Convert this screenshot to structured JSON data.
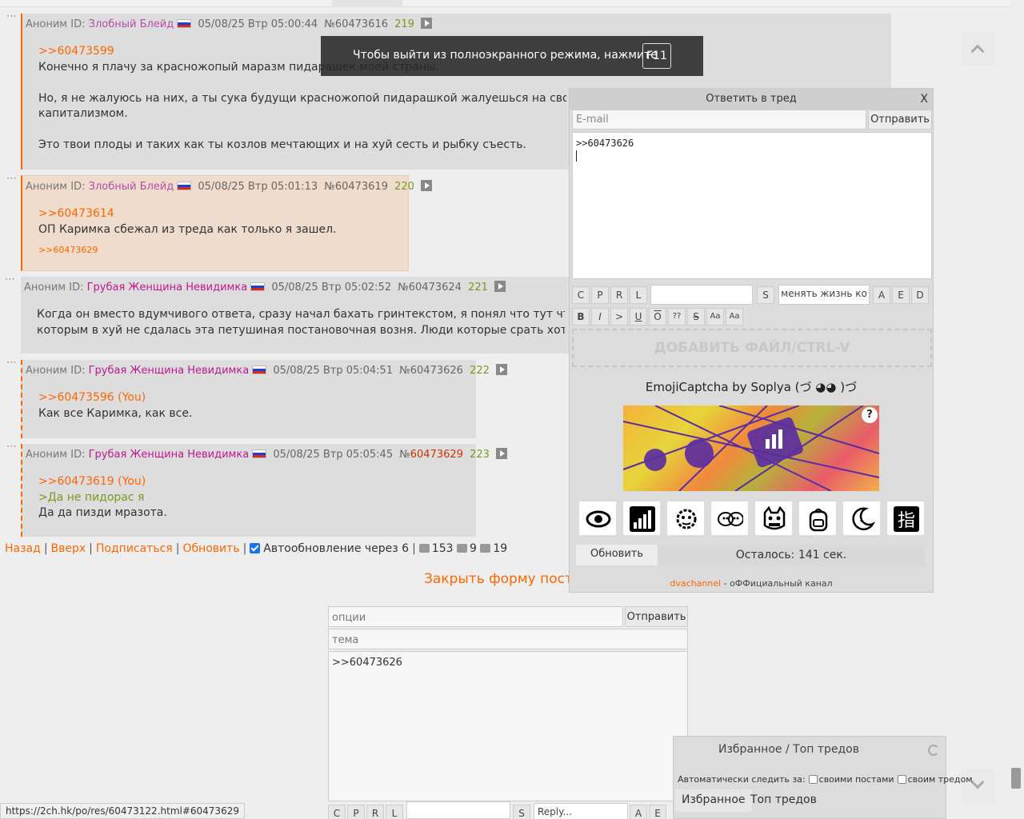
{
  "posts": [
    {
      "anon": "Аноним ID:",
      "name": "Злобный Блейд",
      "date": "05/08/25 Втр 05:00:44",
      "num": "№60473616",
      "count": "219",
      "ref": ">>60473599",
      "lines": [
        "Конечно я плачу за красножопый маразм пидарашек моей страны.",
        "",
        "Но, я не жалуюсь на них, а ты сука будущи красножопой пидарашкой жалуешься на свой собс",
        "капитализмом.",
        "",
        "Это твои плоды и таких как ты козлов мечтающих и на хуй сесть и рыбку съесть."
      ]
    },
    {
      "anon": "Аноним ID:",
      "name": "Злобный Блейд",
      "date": "05/08/25 Втр 05:01:13",
      "num": "№60473619",
      "count": "220",
      "ref": ">>60473614",
      "lines": [
        "ОП Каримка сбежал из треда как только я зашел."
      ],
      "reply_ref": ">>60473629"
    },
    {
      "anon": "Аноним ID:",
      "name": "Грубая Женщина Невидимка",
      "date": "05/08/25 Втр 05:02:52",
      "num": "№60473624",
      "count": "221",
      "lines": [
        "Когда он вместо вдумчивого ответа, сразу начал бахать гринтекстом, я понял что тут что то не",
        "которым в хуй не сдалась эта петушиная постановочная возня. Люди которые срать хотели на"
      ]
    },
    {
      "anon": "Аноним ID:",
      "name": "Грубая Женщина Невидимка",
      "date": "05/08/25 Втр 05:04:51",
      "num": "№60473626",
      "count": "222",
      "ref": ">>60473596 (You)",
      "lines": [
        "Как все Каримка, как все."
      ]
    },
    {
      "anon": "Аноним ID:",
      "name": "Грубая Женщина Невидимка",
      "date": "05/08/25 Втр 05:05:45",
      "num_prefix": "№",
      "num": "60473629",
      "count": "223",
      "ref": ">>60473619 (You)",
      "green": ">Да не пидорас я",
      "lines": [
        "Да да пизди мразота."
      ]
    }
  ],
  "nav": {
    "back": "Назад",
    "top": "Вверх",
    "subscribe": "Подписаться",
    "refresh": "Обновить",
    "autoupdate": "Автообновление через 6",
    "posts_count": "153",
    "images_count": "9",
    "users_count": "19"
  },
  "close_form": "Закрыть форму пости",
  "lower_form": {
    "options_placeholder": "опции",
    "submit": "Отправить",
    "subject_placeholder": "тема",
    "text": ">>60473626",
    "reply_placeholder": "Reply...",
    "fmt": [
      "C",
      "P",
      "R",
      "L",
      "S",
      "A",
      "E"
    ]
  },
  "fullscreen": {
    "message": "Чтобы выйти из полноэкранного режима, нажмите",
    "key": "F11"
  },
  "reply_panel": {
    "title": "Ответить в тред",
    "close": "X",
    "email_placeholder": "E-mail",
    "submit": "Отправить",
    "text": ">>60473626",
    "fmt1": [
      "C",
      "P",
      "R",
      "L"
    ],
    "s_btn": "S",
    "change_life": "менять жизнь ко",
    "fmt2": [
      "A",
      "E",
      "D"
    ],
    "fmt3": [
      "B",
      "I",
      ">",
      "U",
      "O",
      "??",
      "S",
      "Aa",
      "Aa"
    ],
    "dropzone": "ДОБАВИТЬ ФАЙЛ/CTRL-V",
    "captcha_title": "EmojiCaptcha by Soplya (づ ◕◕ )づ",
    "captcha_help": "?",
    "emojis": [
      "eye-icon",
      "signal-bars-icon",
      "virus-icon",
      "two-faces-icon",
      "oni-mask-icon",
      "backpack-icon",
      "moon-icon",
      "finger-kanji-icon"
    ],
    "kanji": "指",
    "refresh": "Обновить",
    "remaining": "Осталось: 141 сек.",
    "footer_link": "dvachannel",
    "footer_text": " - оФФициальный канал"
  },
  "fav_panel": {
    "title": "Избранное / Топ тредов",
    "auto_label": "Автоматически следить за:",
    "own_posts": "своими постами",
    "own_thread": "своим тредом",
    "tab_fav": "Избранное",
    "tab_top": "Топ тредов"
  },
  "status_url": "https://2ch.hk/po/res/60473122.html#60473629"
}
